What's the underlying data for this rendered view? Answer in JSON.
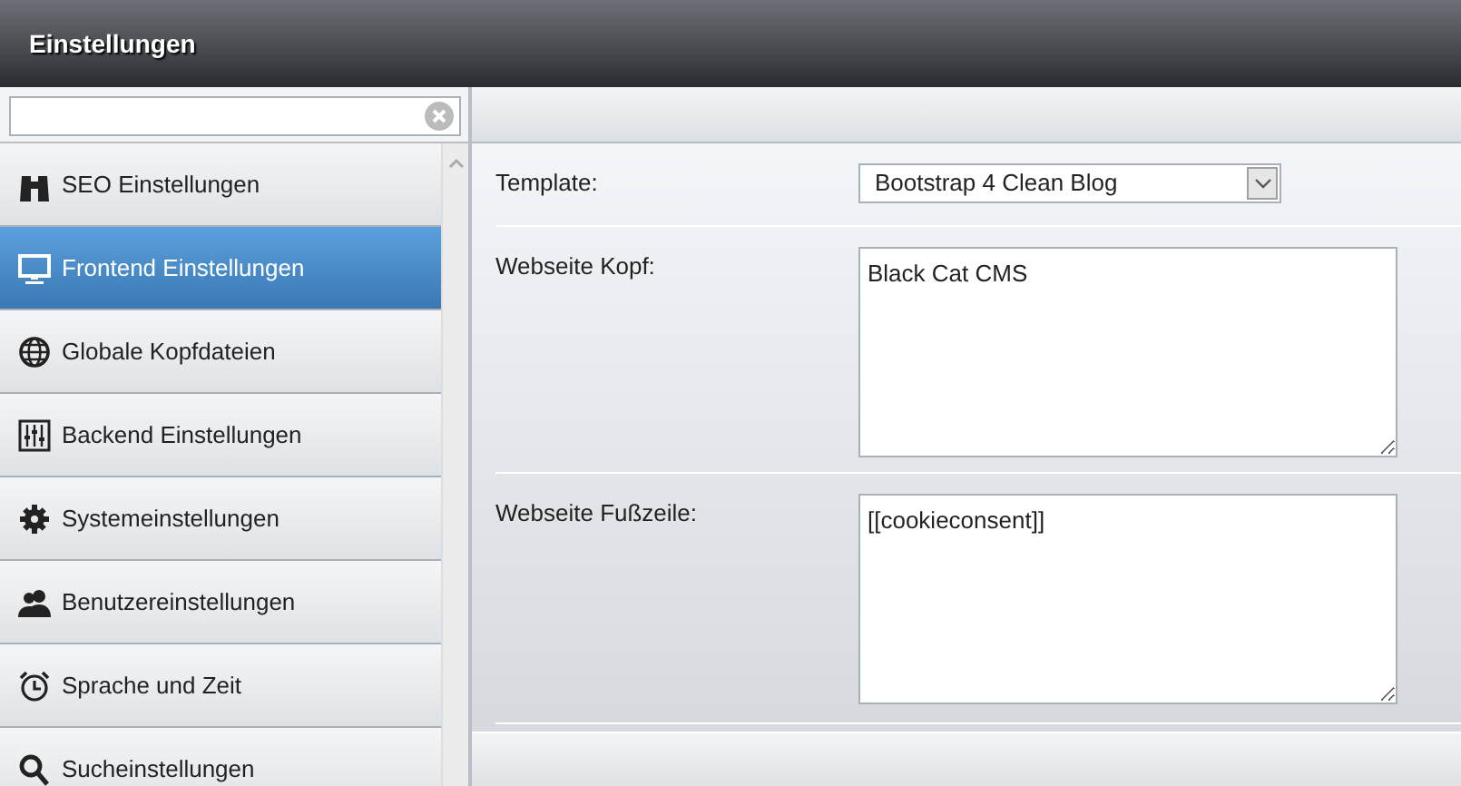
{
  "header": {
    "title": "Einstellungen"
  },
  "sidebar": {
    "items": [
      {
        "label": "SEO Einstellungen",
        "selected": false
      },
      {
        "label": "Frontend Einstellungen",
        "selected": true
      },
      {
        "label": "Globale Kopfdateien",
        "selected": false
      },
      {
        "label": "Backend Einstellungen",
        "selected": false
      },
      {
        "label": "Systemeinstellungen",
        "selected": false
      },
      {
        "label": "Benutzereinstellungen",
        "selected": false
      },
      {
        "label": "Sprache und Zeit",
        "selected": false
      },
      {
        "label": "Sucheinstellungen",
        "selected": false
      }
    ]
  },
  "form": {
    "fields": [
      {
        "kind": "select",
        "label": "Template:",
        "value": "Bootstrap 4 Clean Blog"
      },
      {
        "kind": "textarea",
        "label": "Webseite Kopf:",
        "value": "Black Cat CMS"
      },
      {
        "kind": "textarea",
        "label": "Webseite Fußzeile:",
        "value": "[[cookieconsent]]"
      }
    ]
  }
}
